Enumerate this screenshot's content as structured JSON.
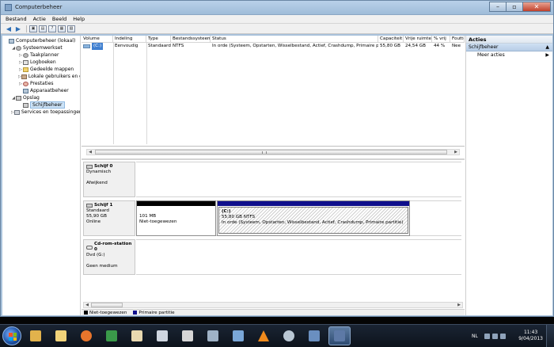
{
  "window": {
    "title": "Computerbeheer"
  },
  "menubar": [
    "Bestand",
    "Actie",
    "Beeld",
    "Help"
  ],
  "toolbar_icons": [
    "back-icon",
    "forward-icon",
    "up-folder-icon",
    "show-tree-icon",
    "help-icon",
    "properties-icon",
    "disk-settings-icon"
  ],
  "tree": [
    {
      "label": "Computerbeheer (lokaal)",
      "level": 0,
      "icon": "computer-icon",
      "expander": ""
    },
    {
      "label": "Systeemwerkset",
      "level": 1,
      "icon": "tools-icon",
      "expander": "◢"
    },
    {
      "label": "Taakplanner",
      "level": 2,
      "icon": "clock-icon",
      "expander": "▷"
    },
    {
      "label": "Logboeken",
      "level": 2,
      "icon": "log-icon",
      "expander": "▷"
    },
    {
      "label": "Gedeelde mappen",
      "level": 2,
      "icon": "folder-icon",
      "expander": "▷"
    },
    {
      "label": "Lokale gebruikers en gro",
      "level": 2,
      "icon": "users-icon",
      "expander": "▷"
    },
    {
      "label": "Prestaties",
      "level": 2,
      "icon": "performance-icon",
      "expander": "▷"
    },
    {
      "label": "Apparaatbeheer",
      "level": 2,
      "icon": "device-icon",
      "expander": ""
    },
    {
      "label": "Opslag",
      "level": 1,
      "icon": "storage-icon",
      "expander": "◢"
    },
    {
      "label": "Schijfbeheer",
      "level": 2,
      "icon": "disk-icon",
      "expander": "",
      "selected": true
    },
    {
      "label": "Services en toepassingen",
      "level": 1,
      "icon": "services-icon",
      "expander": "▷"
    }
  ],
  "volume_table": {
    "columns": [
      "Volume",
      "Indeling",
      "Type",
      "Bestandssysteem",
      "Status",
      "Capaciteit",
      "Vrije ruimte",
      "% vrij",
      "Foutto"
    ],
    "rows": [
      [
        "(C:)",
        "Eenvoudig",
        "Standaard",
        "NTFS",
        "In orde (Systeem, Opstarten, Wisselbestand, Actief, Crashdump, Primaire partitie)",
        "55,80 GB",
        "24,54 GB",
        "44 %",
        "Nee"
      ]
    ]
  },
  "disks": [
    {
      "name": "Schijf 0",
      "lines": [
        "Dynamisch",
        "",
        "Afwijkend"
      ],
      "partitions": []
    },
    {
      "name": "Schijf 1",
      "lines": [
        "Standaard",
        "55,90 GB",
        "Online"
      ],
      "partitions": [
        {
          "kind": "unallocated",
          "lines": [
            "101 MB",
            "Niet-toegewezen"
          ]
        },
        {
          "kind": "primary",
          "lines": [
            "(C:)",
            "55,80 GB NTFS",
            "In orde (Systeem, Opstarten, Wisselbestand, Actief, Crashdump, Primaire partitie)"
          ]
        }
      ]
    },
    {
      "name": "Cd-rom-station 0",
      "lines": [
        "Dvd (G:)",
        "",
        "Geen medium"
      ],
      "partitions": []
    }
  ],
  "legend": [
    {
      "label": "Niet-toegewezen",
      "color": "#000000"
    },
    {
      "label": "Primaire partitie",
      "color": "#0f0f8c"
    }
  ],
  "actions": {
    "header": "Acties",
    "section": "Schijfbeheer",
    "items": [
      "Meer acties"
    ]
  },
  "taskbar": {
    "language": "NL",
    "time": "11:43",
    "date": "9/04/2013",
    "apps": [
      "explorer-icon",
      "folder-icon",
      "firefox-icon",
      "excel-icon",
      "photo-icon",
      "steam-icon",
      "database-icon",
      "tools-icon",
      "network-icon",
      "vlc-icon",
      "settings-icon",
      "remote-desktop-icon",
      "computer-management-icon"
    ]
  },
  "colors": {
    "title_gradient": "#b9d1ea",
    "selected_volume": "#3f7fd0",
    "primary_partition": "#0f0f8c",
    "actions_section": "#cfe0f3"
  }
}
